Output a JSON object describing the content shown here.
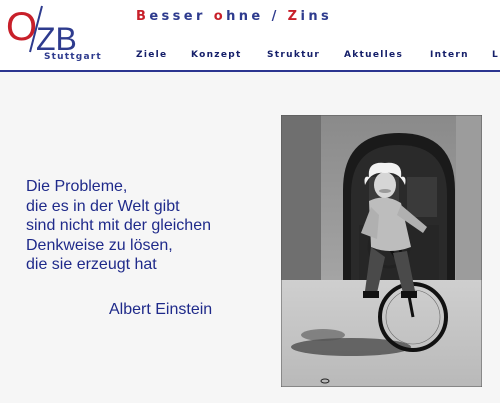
{
  "logo": {
    "letters_left": "O",
    "letters_right": "ZB",
    "subtitle": "Stuttgart"
  },
  "tagline": {
    "word1_initial": "B",
    "word1_rest": "esser ",
    "word2_initial": "o",
    "word2_rest": "hne ",
    "slash": "/ ",
    "word3_initial": "Z",
    "word3_rest": "ins"
  },
  "nav": {
    "items": [
      {
        "label": "Ziele"
      },
      {
        "label": "Konzept"
      },
      {
        "label": "Struktur"
      },
      {
        "label": "Aktuelles"
      },
      {
        "label": "Intern"
      },
      {
        "label": "L"
      }
    ]
  },
  "quote": {
    "lines": [
      "Die Probleme,",
      "die es in der Welt gibt",
      "sind nicht mit der gleichen",
      "Denkweise zu lösen,",
      "die sie erzeugt hat"
    ],
    "author": "Albert Einstein"
  },
  "colors": {
    "navy": "#2e3b8e",
    "red": "#c8202a",
    "quote_blue": "#1f2a8a"
  }
}
